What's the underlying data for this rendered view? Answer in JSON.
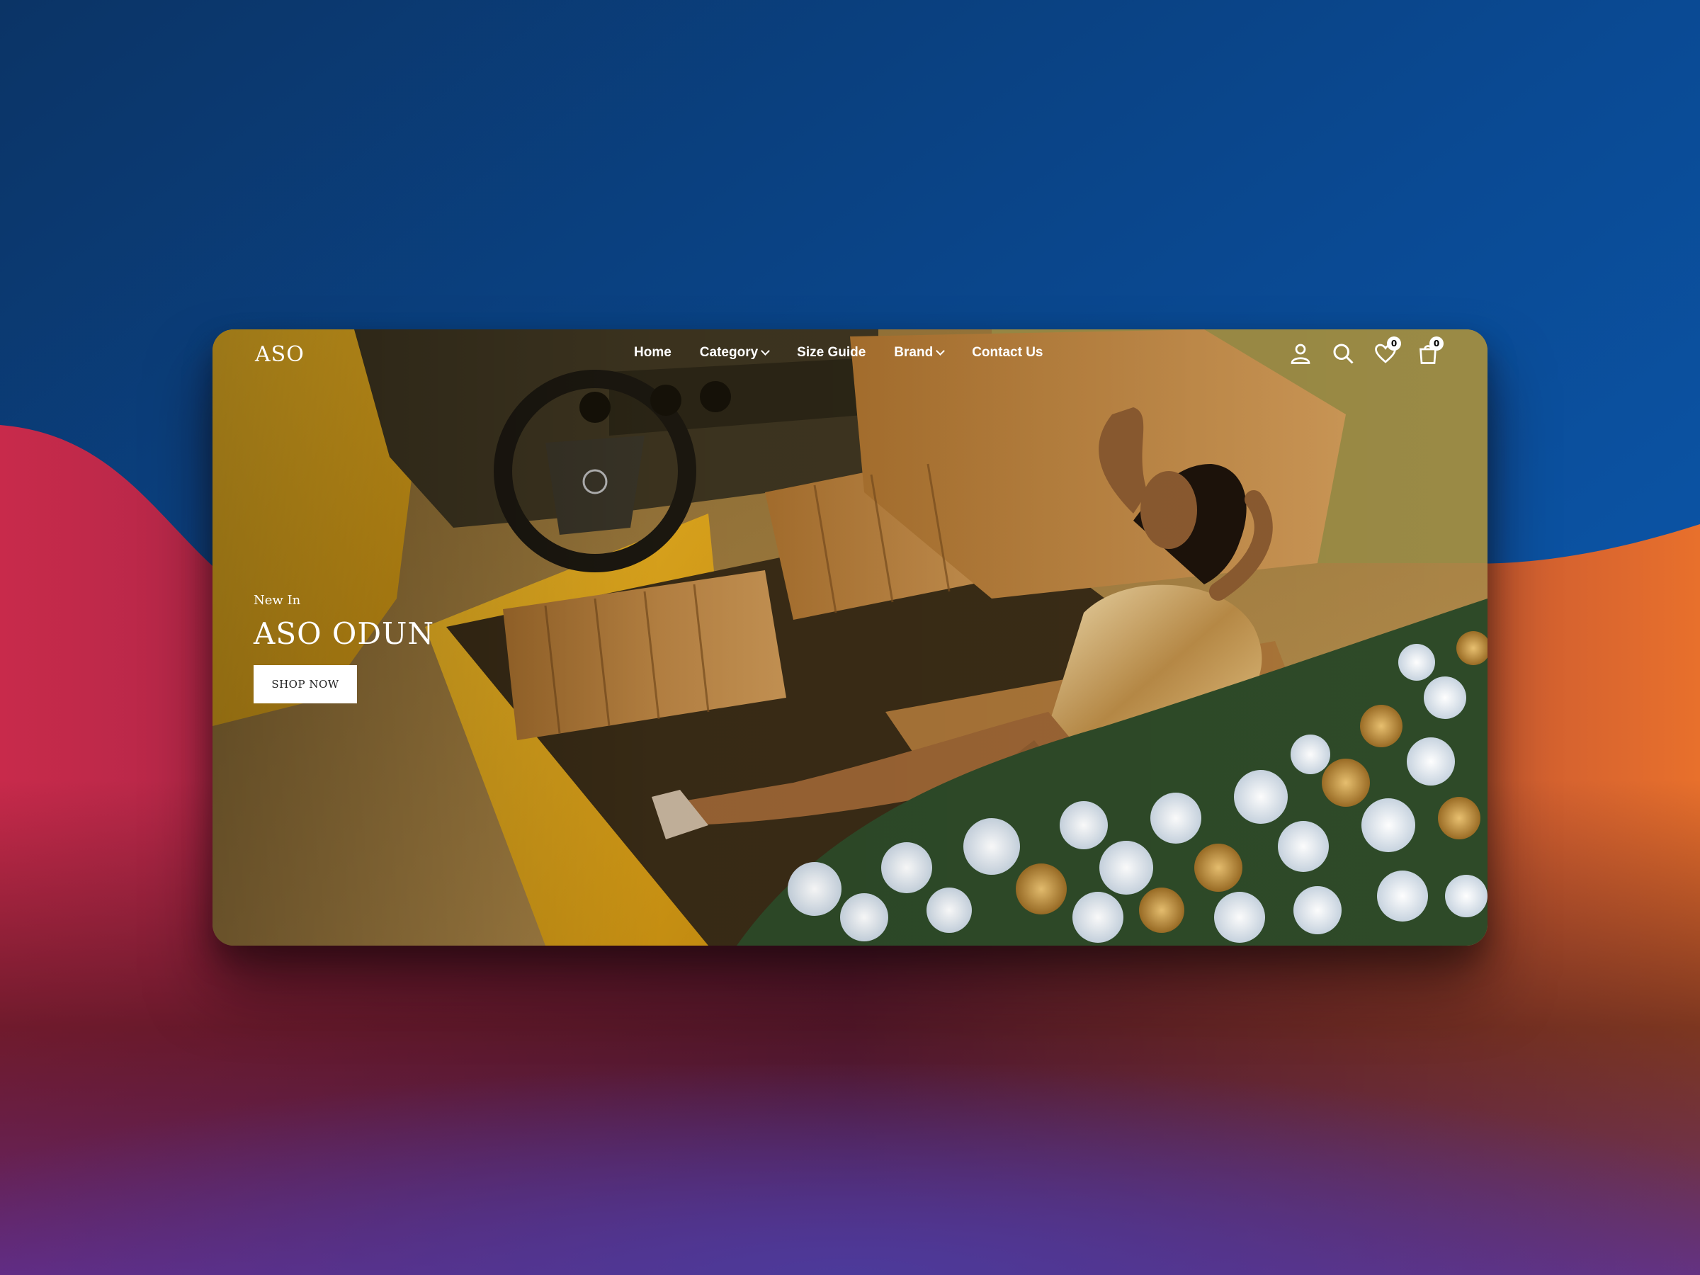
{
  "brand": {
    "logo": "ASO"
  },
  "nav": {
    "items": [
      {
        "label": "Home",
        "has_dropdown": false
      },
      {
        "label": "Category",
        "has_dropdown": true
      },
      {
        "label": "Size Guide",
        "has_dropdown": false
      },
      {
        "label": "Brand",
        "has_dropdown": true
      },
      {
        "label": "Contact Us",
        "has_dropdown": false
      }
    ]
  },
  "header_icons": {
    "account": "user-icon",
    "search": "search-icon",
    "wishlist": {
      "icon": "heart-icon",
      "count": "0"
    },
    "cart": {
      "icon": "shopping-bag-icon",
      "count": "0"
    }
  },
  "hero": {
    "eyebrow": "New In",
    "title": "ASO ODUN",
    "cta_label": "SHOP NOW"
  },
  "colors": {
    "backdrop_blue": "#0a4f9e",
    "backdrop_red": "#c8284a",
    "backdrop_orange": "#e86a2a",
    "car_yellow": "#e0a81e",
    "leather_tan": "#b98242"
  }
}
